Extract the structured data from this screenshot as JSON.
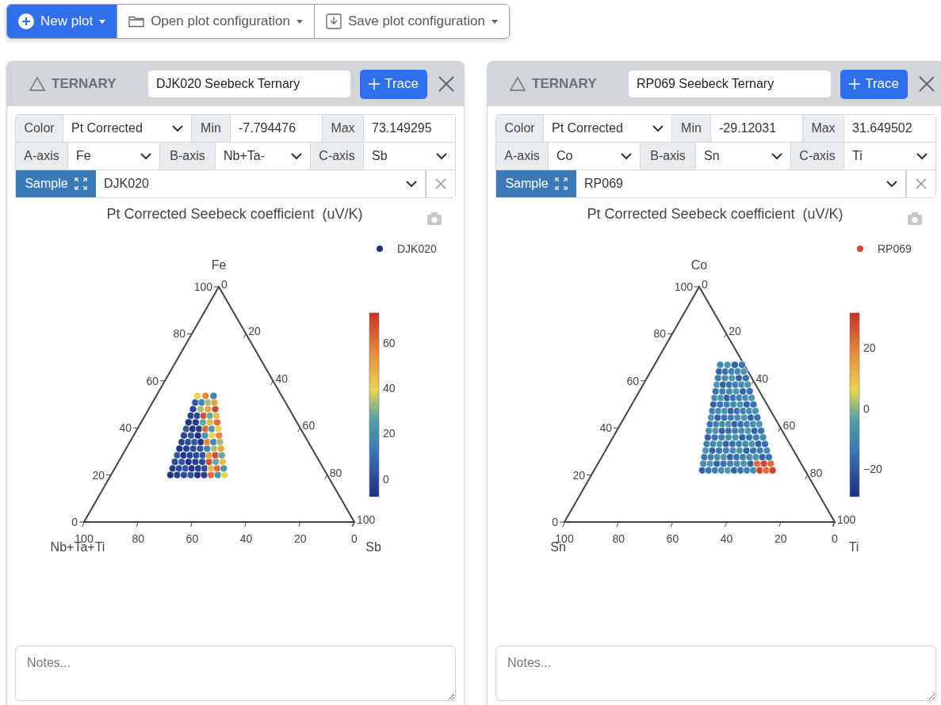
{
  "toolbar": [
    {
      "label": "New plot",
      "kind": "primary"
    },
    {
      "label": "Open plot configuration",
      "kind": "open"
    },
    {
      "label": "Save plot configuration",
      "kind": "save"
    }
  ],
  "panels": [
    {
      "type_label": "TERNARY",
      "title": "DJK020 Seebeck Ternary",
      "trace_button": "Trace",
      "color": {
        "label": "Color",
        "value": "Pt Corrected"
      },
      "min": {
        "label": "Min",
        "value": "-7.794476"
      },
      "max": {
        "label": "Max",
        "value": "73.149295"
      },
      "axes": [
        {
          "label": "A-axis",
          "value": "Fe"
        },
        {
          "label": "B-axis",
          "value": "Nb+Ta-"
        },
        {
          "label": "C-axis",
          "value": "Sb"
        }
      ],
      "sample": {
        "label": "Sample",
        "value": "DJK020"
      },
      "plot": {
        "title": "Pt Corrected Seebeck coefficient  (uV/K)",
        "legend": {
          "name": "DJK020",
          "color": "#1f2f86"
        },
        "a_title": "Fe",
        "b_title": "Nb+Ta+Ti",
        "c_title": "Sb",
        "a_ticks": [
          "0",
          "20",
          "40",
          "60",
          "80",
          "100"
        ],
        "b_ticks": [
          "100",
          "80",
          "60",
          "40",
          "20",
          "0"
        ],
        "c_ticks": [
          "0",
          "20",
          "40",
          "60",
          "80",
          "100"
        ],
        "colorbar_ticks": [
          "60",
          "40",
          "20",
          "0"
        ]
      },
      "notes_placeholder": "Notes..."
    },
    {
      "type_label": "TERNARY",
      "title": "RP069 Seebeck Ternary",
      "trace_button": "Trace",
      "color": {
        "label": "Color",
        "value": "Pt Corrected"
      },
      "min": {
        "label": "Min",
        "value": "-29.12031"
      },
      "max": {
        "label": "Max",
        "value": "31.649502"
      },
      "axes": [
        {
          "label": "A-axis",
          "value": "Co"
        },
        {
          "label": "B-axis",
          "value": "Sn"
        },
        {
          "label": "C-axis",
          "value": "Ti"
        }
      ],
      "sample": {
        "label": "Sample",
        "value": "RP069"
      },
      "plot": {
        "title": "Pt Corrected Seebeck coefficient  (uV/K)",
        "legend": {
          "name": "RP069",
          "color": "#d9462b"
        },
        "a_title": "Co",
        "b_title": "Sn",
        "c_title": "Ti",
        "a_ticks": [
          "0",
          "20",
          "40",
          "60",
          "80",
          "100"
        ],
        "b_ticks": [
          "100",
          "80",
          "60",
          "40",
          "20",
          "0"
        ],
        "c_ticks": [
          "0",
          "20",
          "40",
          "60",
          "80",
          "100"
        ],
        "colorbar_ticks": [
          "20",
          "0",
          "−20"
        ]
      },
      "notes_placeholder": "Notes..."
    }
  ]
}
